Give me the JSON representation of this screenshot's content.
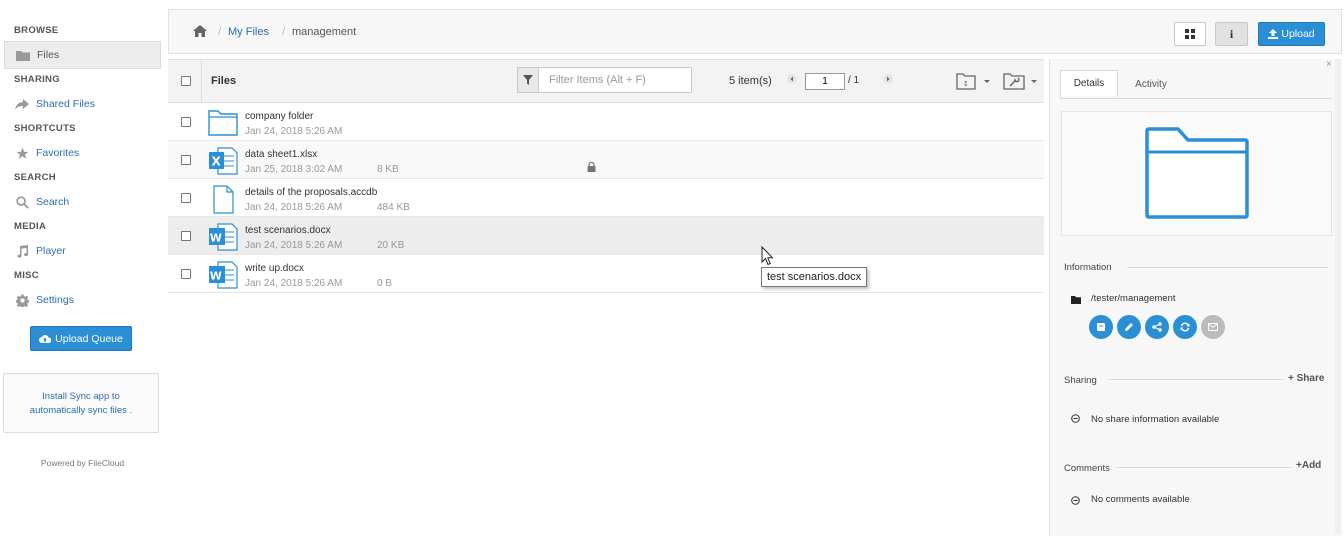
{
  "sidebar": {
    "sections": {
      "browse": "BROWSE",
      "sharing": "SHARING",
      "shortcuts": "SHORTCUTS",
      "search": "SEARCH",
      "media": "MEDIA",
      "misc": "MISC"
    },
    "items": {
      "files": "Files",
      "shared_files": "Shared Files",
      "favorites": "Favorites",
      "search": "Search",
      "player": "Player",
      "settings": "Settings"
    },
    "upload_queue_label": "Upload Queue",
    "sync_text_line1": "Install Sync app to",
    "sync_text_line2": "automatically sync files .",
    "powered_by": "Powered by FileCloud"
  },
  "breadcrumb": {
    "home_icon": "home-icon",
    "my_files": "My Files",
    "current": "management",
    "separator": "/"
  },
  "toolbar": {
    "upload_label": "Upload",
    "info_label": "i"
  },
  "list_header": {
    "files_label": "Files",
    "filter_placeholder": "Filter Items (Alt + F)",
    "item_count": "5 item(s)",
    "page_value": "1",
    "page_total": "/ 1"
  },
  "files": [
    {
      "name": "company folder",
      "date": "Jan 24, 2018 5:26 AM",
      "size": "",
      "type": "folder-icon"
    },
    {
      "name": "data sheet1.xlsx",
      "date": "Jan 25, 2018 3:02 AM",
      "size": "8 KB",
      "type": "excel-icon",
      "locked": true
    },
    {
      "name": "details of the proposals.accdb",
      "date": "Jan 24, 2018 5:26 AM",
      "size": "484 KB",
      "type": "file-icon"
    },
    {
      "name": "test scenarios.docx",
      "date": "Jan 24, 2018 5:26 AM",
      "size": "20 KB",
      "type": "word-icon"
    },
    {
      "name": "write up.docx",
      "date": "Jan 24, 2018 5:26 AM",
      "size": "0 B",
      "type": "word-icon"
    }
  ],
  "tooltip": "test scenarios.docx",
  "details_panel": {
    "tabs": {
      "details": "Details",
      "activity": "Activity"
    },
    "information_label": "Information",
    "path": "/tester/management",
    "sharing_label": "Sharing",
    "share_add": "Share",
    "no_share": "No share information available",
    "comments_label": "Comments",
    "comment_add": "Add",
    "no_comments": "No comments available",
    "close": "×"
  },
  "colors": {
    "accent": "#2b8fd6",
    "link": "#2a6fb0",
    "excel": "#2b8fd6",
    "word": "#2b8fd6"
  }
}
